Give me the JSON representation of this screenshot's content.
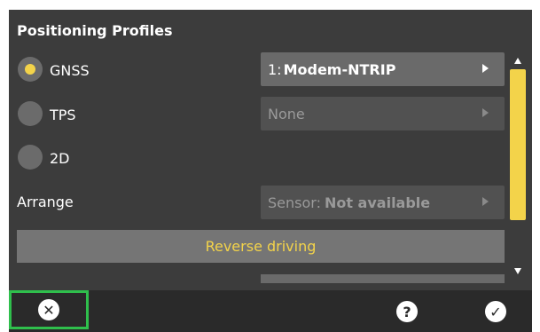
{
  "section": {
    "title": "Positioning Profiles"
  },
  "profiles": {
    "gnss": {
      "label": "GNSS",
      "selected": true,
      "value_prefix": "1:",
      "value": "Modem-NTRIP"
    },
    "tps": {
      "label": "TPS",
      "selected": false,
      "value": "None"
    },
    "twod": {
      "label": "2D",
      "selected": false
    }
  },
  "arrange": {
    "label": "Arrange",
    "prefix": "Sensor:",
    "value": "Not available"
  },
  "buttons": {
    "reverse_driving": "Reverse driving"
  },
  "icons": {
    "close": "✕",
    "help": "?",
    "ok": "✓"
  },
  "colors": {
    "accent": "#f3d34a",
    "highlight": "#2fbf4c",
    "panel": "#3c3c3c"
  }
}
